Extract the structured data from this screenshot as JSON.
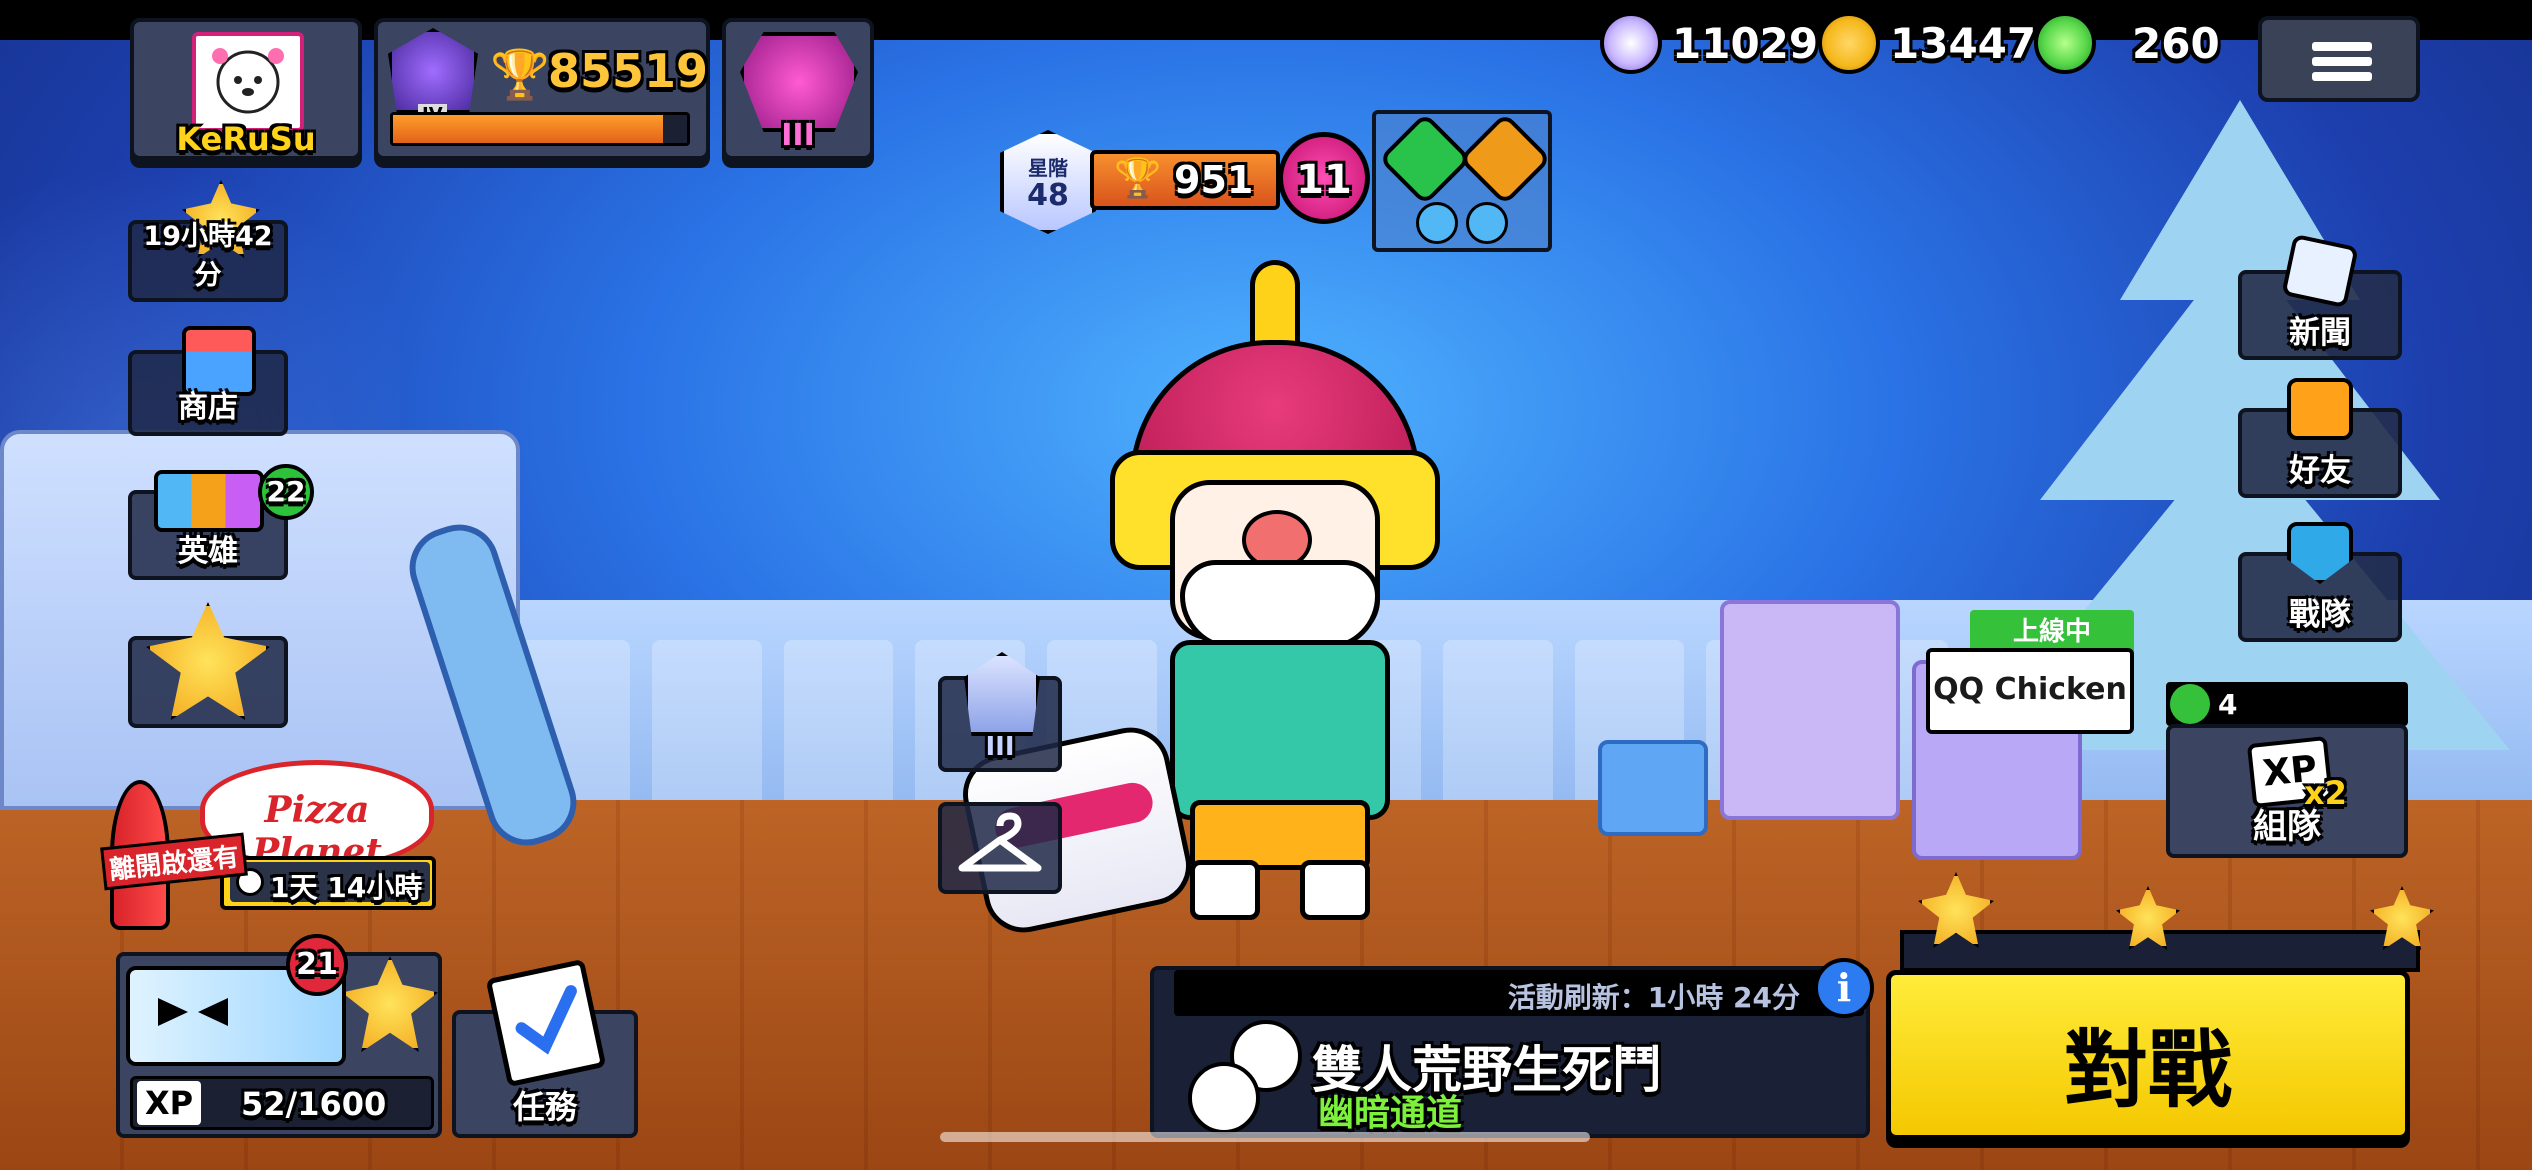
{
  "player": {
    "name": "KeRuSu",
    "trophies": "85519",
    "rank_roman": "IV",
    "ranked_tier": "III"
  },
  "currencies": [
    {
      "icon": "power-points-icon",
      "value": "11029",
      "color": "#c9b8ff"
    },
    {
      "icon": "coins-icon",
      "value": "13447",
      "color": "#f5b81c"
    },
    {
      "icon": "gems-icon",
      "value": "260",
      "color": "#58d84a"
    }
  ],
  "brawler": {
    "rank_label": "星階",
    "rank": "48",
    "trophies": "951",
    "power_level": "11",
    "skin_tier": "III"
  },
  "sidebar": {
    "event_timer": "19小時42分",
    "shop_label": "商店",
    "brawlers_label": "英雄",
    "brawlers_badge": "22"
  },
  "event_banner": {
    "title": "Pizza Planet",
    "leave_label": "離開啟還有",
    "timer": "1天 14小時"
  },
  "brawl_pass": {
    "badge": "21",
    "xp_label": "XP",
    "xp_progress": "52/1600"
  },
  "quests_label": "任務",
  "game_mode": {
    "refresh_label": "活動刷新：1小時 24分",
    "name": "雙人荒野生死鬥",
    "map": "幽暗通道"
  },
  "right_menu": {
    "news_label": "新聞",
    "friends_label": "好友",
    "club_label": "戰隊",
    "friend_status": "上線中",
    "friend_name": "QQ Chicken",
    "team_online_count": "4",
    "team_xp": "XP",
    "team_xp_mult": "x2",
    "team_label": "組隊"
  },
  "play_label": "對戰",
  "colors": {
    "accent_yellow": "#ffe32b",
    "trophy_orange": "#f59a1c",
    "online_green": "#35c23a",
    "power_pink": "#e0188a"
  }
}
